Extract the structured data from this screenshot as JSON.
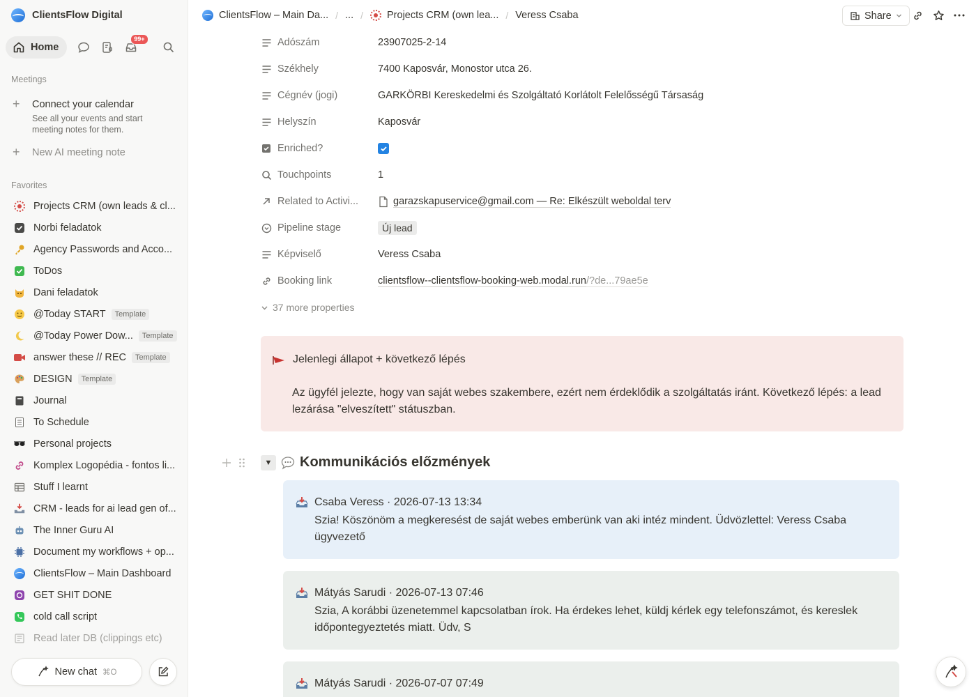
{
  "sidebar": {
    "workspace": "ClientsFlow Digital",
    "home_label": "Home",
    "inbox_badge": "99+",
    "meetings_label": "Meetings",
    "connect_calendar_title": "Connect your calendar",
    "connect_calendar_sub": "See all your events and start meeting notes for them.",
    "new_ai_note": "New AI meeting note",
    "favorites_label": "Favorites",
    "favorites": [
      {
        "label": "Projects CRM (own leads & cl...",
        "icon": "crm-target-icon"
      },
      {
        "label": "Norbi feladatok",
        "icon": "checkbox-dark-icon"
      },
      {
        "label": "Agency Passwords and Acco...",
        "icon": "key-icon"
      },
      {
        "label": "ToDos",
        "icon": "check-green-icon"
      },
      {
        "label": "Dani feladatok",
        "icon": "cat-icon"
      },
      {
        "label": "@Today START",
        "icon": "smile-icon",
        "tag": "Template"
      },
      {
        "label": "@Today Power Dow...",
        "icon": "moon-icon",
        "tag": "Template"
      },
      {
        "label": "answer these // REC",
        "icon": "video-camera-icon",
        "tag": "Template"
      },
      {
        "label": "DESIGN",
        "icon": "palette-icon",
        "tag": "Template"
      },
      {
        "label": "Journal",
        "icon": "notebook-icon"
      },
      {
        "label": "To Schedule",
        "icon": "ledger-icon"
      },
      {
        "label": "Personal projects",
        "icon": "sunglasses-icon"
      },
      {
        "label": "Komplex Logopédia - fontos li...",
        "icon": "link-icon"
      },
      {
        "label": "Stuff I learnt",
        "icon": "table-icon"
      },
      {
        "label": "CRM - leads for ai lead gen of...",
        "icon": "inbox-tray-icon"
      },
      {
        "label": "The Inner Guru AI",
        "icon": "robot-icon"
      },
      {
        "label": "Document my workflows + op...",
        "icon": "chip-icon"
      },
      {
        "label": "ClientsFlow – Main Dashboard",
        "icon": "clientsflow-logo-icon"
      },
      {
        "label": "GET SHIT DONE",
        "icon": "purple-app-icon"
      },
      {
        "label": "cold call script",
        "icon": "phone-icon"
      },
      {
        "label": "Read later DB (clippings etc)",
        "icon": "newspaper-icon"
      }
    ],
    "new_chat": "New chat",
    "new_chat_shortcut": "⌘O"
  },
  "topbar": {
    "crumb1": "ClientsFlow – Main Da...",
    "crumb2": "...",
    "crumb3": "Projects CRM (own lea...",
    "crumb4": "Veress Csaba",
    "share": "Share"
  },
  "properties": [
    {
      "name": "Adószám",
      "value": "23907025-2-14",
      "icon": "text-lines-icon"
    },
    {
      "name": "Székhely",
      "value": "7400 Kaposvár, Monostor utca 26.",
      "icon": "text-lines-icon"
    },
    {
      "name": "Cégnév (jogi)",
      "value": "GARKÖRBI Kereskedelmi és Szolgáltató Korlátolt Felelősségű Társaság",
      "icon": "text-lines-icon"
    },
    {
      "name": "Helyszín",
      "value": "Kaposvár",
      "icon": "text-lines-icon"
    },
    {
      "name": "Enriched?",
      "value": "",
      "icon": "checkbox-prop-icon"
    },
    {
      "name": "Touchpoints",
      "value": "1",
      "icon": "search-prop-icon"
    },
    {
      "name": "Related to Activi...",
      "value": "garazskapuservice@gmail.com — Re: Elkészült weboldal terv",
      "icon": "arrow-up-right-icon"
    },
    {
      "name": "Pipeline stage",
      "value": "Új lead",
      "icon": "status-icon"
    },
    {
      "name": "Képviselő",
      "value": "Veress Csaba",
      "icon": "text-lines-icon"
    },
    {
      "name": "Booking link",
      "value": "clientsflow--clientsflow-booking-web.modal.run",
      "value_rest": "/?de...79ae5e",
      "icon": "link-prop-icon"
    }
  ],
  "more_properties": "37 more properties",
  "callout": {
    "title": "Jelenlegi állapot + következő lépés",
    "body": "Az ügyfél jelezte, hogy van saját webes szakembere, ezért nem érdeklődik a szolgáltatás iránt. Következő lépés: a lead lezárása \"elveszített\" státuszban."
  },
  "history": {
    "title": "Kommunikációs előzmények",
    "messages": [
      {
        "header": "Csaba Veress · 2026-07-13 13:34",
        "body": "Szia! Köszönöm a megkeresést de saját webes emberünk van aki intéz mindent. Üdvözlettel: Veress Csaba ügyvezető"
      },
      {
        "header": "Mátyás Sarudi · 2026-07-13 07:46",
        "body": "Szia, A korábbi üzenetemmel kapcsolatban írok. Ha érdekes lehet, küldj kérlek egy telefonszámot, és kereslek időpontegyeztetés miatt. Üdv, S"
      },
      {
        "header": "Mátyás Sarudi · 2026-07-07 07:49",
        "body": ""
      }
    ]
  },
  "colors": {
    "accent": "#2383e2",
    "callout_bg": "#f9e9e7",
    "msg_blue": "#e7f0f9",
    "msg_gray": "#ebefec",
    "badge": "#eb5757"
  }
}
